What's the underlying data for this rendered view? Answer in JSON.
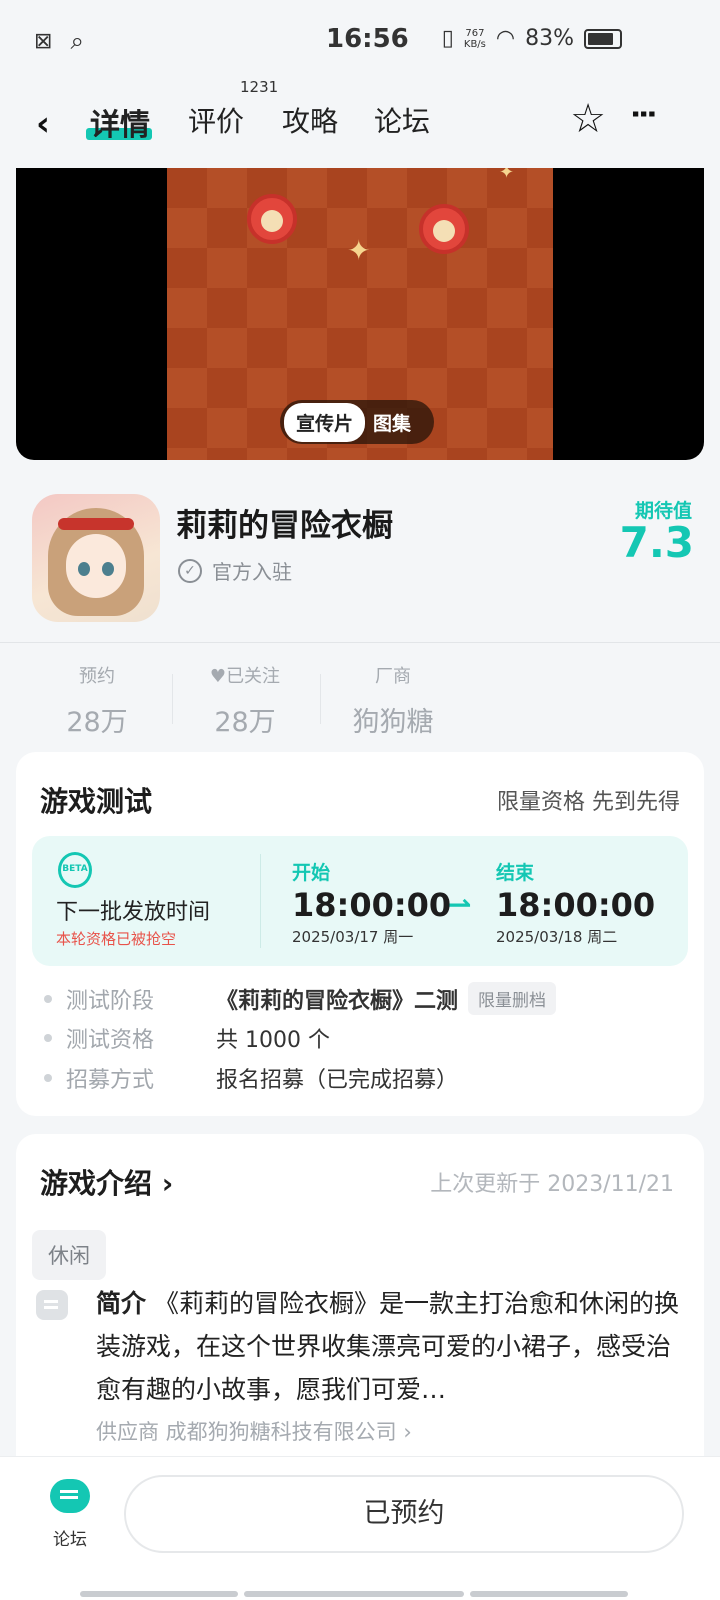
{
  "status_bar": {
    "time": "16:56",
    "net_speed_value": "767",
    "net_speed_unit": "KB/s",
    "battery": "83%",
    "battery_level": 0.83
  },
  "nav": {
    "tabs": [
      "详情",
      "评价",
      "攻略",
      "论坛"
    ],
    "review_count": "1231"
  },
  "media": {
    "switch_active": "宣传片",
    "switch_other": "图集"
  },
  "game": {
    "title": "莉莉的冒险衣橱",
    "official": "官方入驻",
    "expect_label": "期待值",
    "expect_value": "7.3"
  },
  "stats": [
    {
      "label": "预约",
      "value": "28万"
    },
    {
      "label": "已关注",
      "value": "28万"
    },
    {
      "label": "厂商",
      "value": "狗狗糖"
    }
  ],
  "test": {
    "title": "游戏测试",
    "right_text": "限量资格 先到先得",
    "badge": "BETA",
    "next_batch": "下一批发放时间",
    "sold_out": "本轮资格已被抢空",
    "start_label": "开始",
    "start_time": "18:00:00",
    "start_date": "2025/03/17  周一",
    "end_label": "结束",
    "end_time": "18:00:00",
    "end_date": "2025/03/18   周二",
    "rows": [
      {
        "key": "测试阶段",
        "value": "《莉莉的冒险衣橱》二测",
        "tag": "限量删档"
      },
      {
        "key": "测试资格",
        "value": "共 1000 个"
      },
      {
        "key": "招募方式",
        "value": "报名招募（已完成招募）"
      }
    ]
  },
  "intro": {
    "title": "游戏介绍",
    "updated": "上次更新于 2023/11/21",
    "chip": "休闲",
    "label": "简介",
    "text": "《莉莉的冒险衣橱》是一款主打治愈和休闲的换装游戏，在这个世界收集漂亮可爱的小裙子，感受治愈有趣的小故事，愿我们可爱…",
    "supplier": "供应商 成都狗狗糖科技有限公司 ›"
  },
  "bottom": {
    "forum_label": "论坛",
    "reserve_label": "已预约"
  },
  "colors": {
    "accent": "#14c7b3",
    "warning": "#e8534a"
  }
}
